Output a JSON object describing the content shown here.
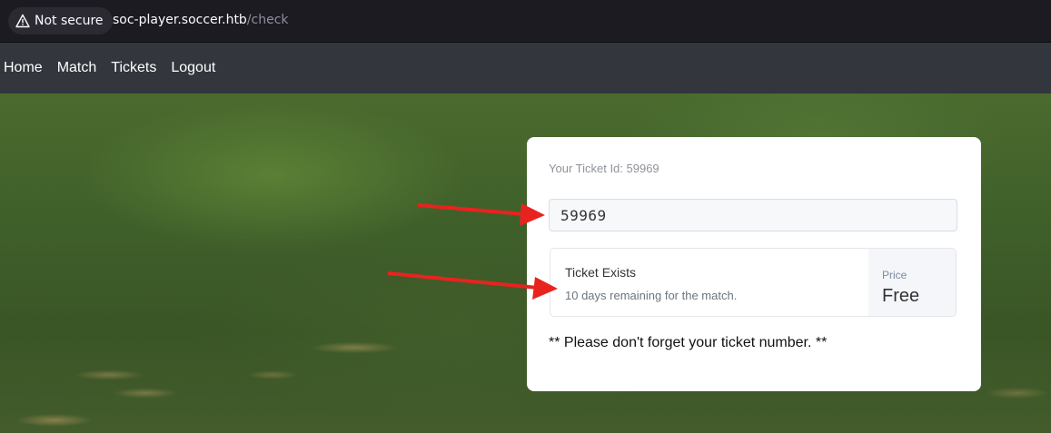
{
  "browser": {
    "security_label": "Not secure",
    "url_host": "soc-player.soccer.htb",
    "url_path": "/check"
  },
  "nav": {
    "items": [
      "Home",
      "Match",
      "Tickets",
      "Logout"
    ]
  },
  "card": {
    "ticket_id_text": "Your Ticket Id: 59969",
    "input_value": "59969",
    "result": {
      "status": "Ticket Exists",
      "remaining": "10 days remaining for the match.",
      "price_label": "Price",
      "price_value": "Free"
    },
    "reminder": "** Please don't forget your ticket number. **"
  },
  "colors": {
    "annotation_arrow": "#e8231f",
    "navbar_bg": "#33363d"
  }
}
